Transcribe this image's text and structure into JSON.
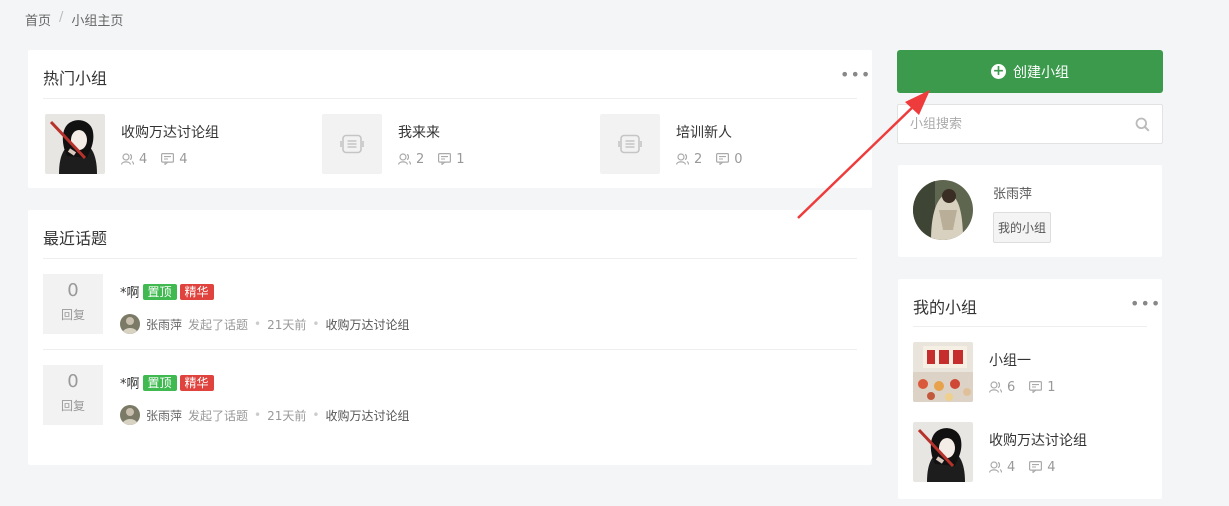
{
  "breadcrumb": {
    "home": "首页",
    "separator": "/",
    "current": "小组主页"
  },
  "hot_groups": {
    "title": "热门小组",
    "more": "•••",
    "items": [
      {
        "name": "收购万达讨论组",
        "members": "4",
        "topics": "4",
        "thumb": "anime-avatar"
      },
      {
        "name": "我来来",
        "members": "2",
        "topics": "1",
        "thumb": "placeholder-icon"
      },
      {
        "name": "培训新人",
        "members": "2",
        "topics": "0",
        "thumb": "placeholder-icon"
      }
    ]
  },
  "recent_topics": {
    "title": "最近话题",
    "items": [
      {
        "replies": "0",
        "reply_label": "回复",
        "title": "*啊",
        "tag_top": "置顶",
        "tag_best": "精华",
        "author": "张雨萍",
        "action": "发起了话题",
        "time": "21天前",
        "group": "收购万达讨论组"
      },
      {
        "replies": "0",
        "reply_label": "回复",
        "title": "*啊",
        "tag_top": "置顶",
        "tag_best": "精华",
        "author": "张雨萍",
        "action": "发起了话题",
        "time": "21天前",
        "group": "收购万达讨论组"
      }
    ]
  },
  "sidebar": {
    "create_label": "创建小组",
    "search_placeholder": "小组搜索",
    "user": {
      "name": "张雨萍",
      "my_groups_button": "我的小组"
    },
    "my_groups": {
      "title": "我的小组",
      "more": "•••",
      "items": [
        {
          "name": "小组一",
          "members": "6",
          "topics": "1",
          "thumb": "restaurant-photo"
        },
        {
          "name": "收购万达讨论组",
          "members": "4",
          "topics": "4",
          "thumb": "anime-avatar"
        }
      ]
    }
  },
  "colors": {
    "accent": "#3b9a4c",
    "tag_green": "#3fb950",
    "tag_red": "#e0433d",
    "arrow": "#ee3b3b"
  },
  "dot": "•"
}
